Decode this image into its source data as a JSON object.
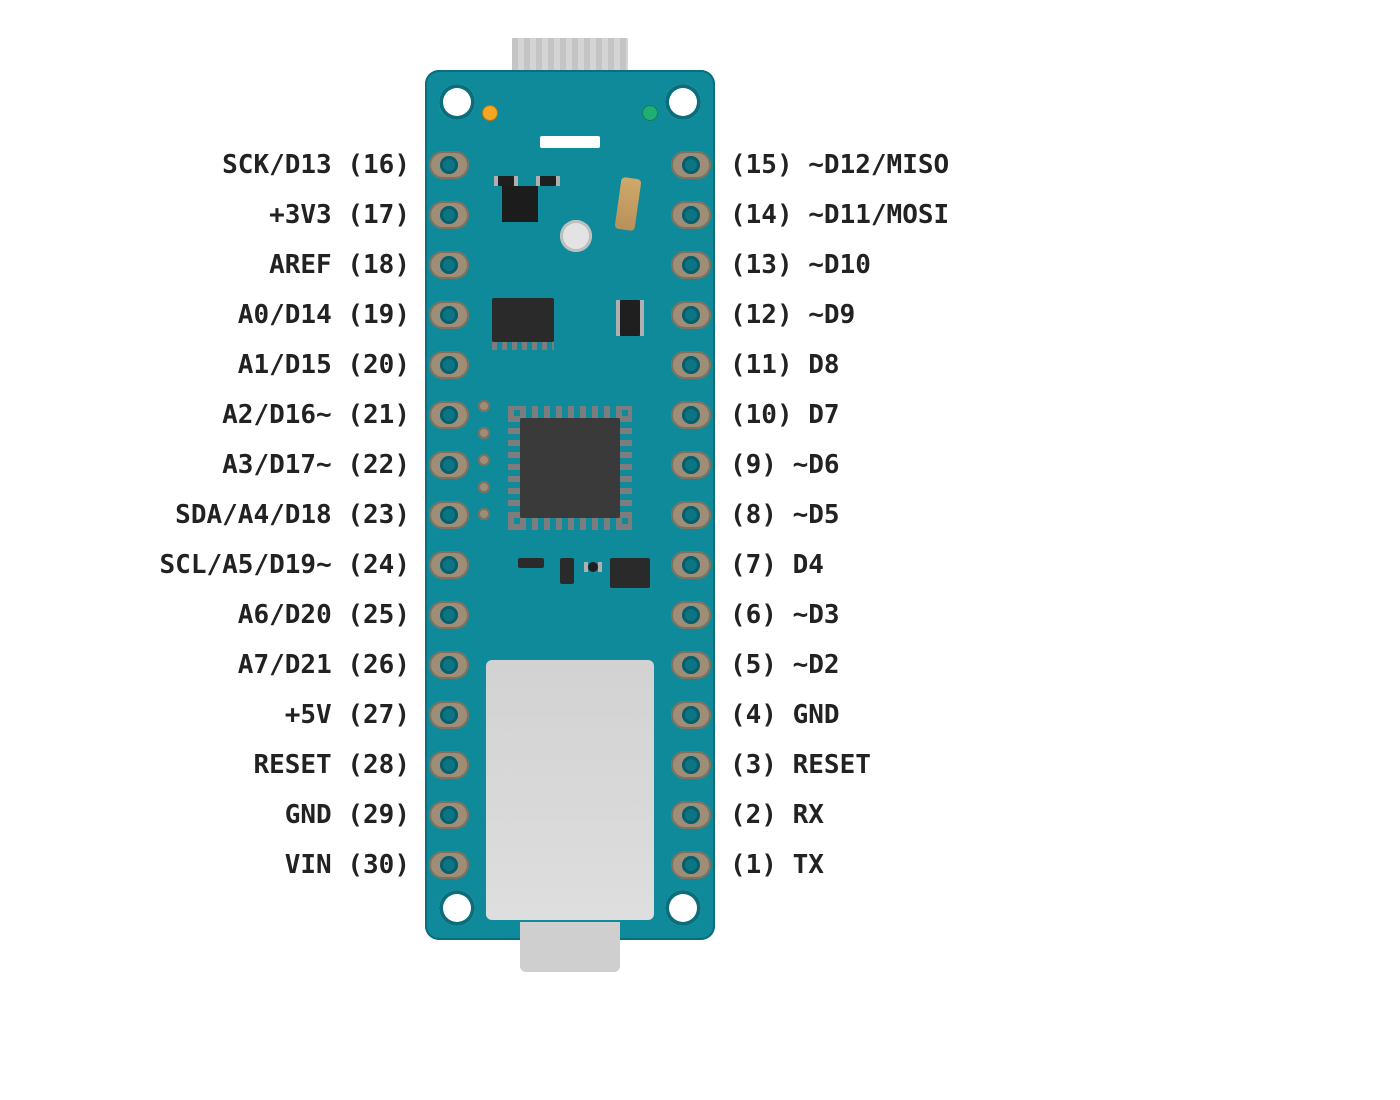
{
  "board": {
    "type": "Arduino-Nano-style microcontroller board pinout diagram",
    "colors": {
      "pcb": "#0f8a9a",
      "pcb_edge": "#0a6f7c",
      "pad": "#9e8e78",
      "pad_hole": "#0b7584",
      "metal": "#d2d2d2",
      "led_orange": "#f5a623",
      "led_green": "#1fae74",
      "text": "#222222"
    }
  },
  "left_pins": [
    {
      "num": "(16)",
      "name": "SCK/D13"
    },
    {
      "num": "(17)",
      "name": "+3V3"
    },
    {
      "num": "(18)",
      "name": "AREF"
    },
    {
      "num": "(19)",
      "name": "A0/D14"
    },
    {
      "num": "(20)",
      "name": "A1/D15"
    },
    {
      "num": "(21)",
      "name": "A2/D16~"
    },
    {
      "num": "(22)",
      "name": "A3/D17~"
    },
    {
      "num": "(23)",
      "name": "SDA/A4/D18"
    },
    {
      "num": "(24)",
      "name": "SCL/A5/D19~"
    },
    {
      "num": "(25)",
      "name": "A6/D20"
    },
    {
      "num": "(26)",
      "name": "A7/D21"
    },
    {
      "num": "(27)",
      "name": "+5V"
    },
    {
      "num": "(28)",
      "name": "RESET"
    },
    {
      "num": "(29)",
      "name": "GND"
    },
    {
      "num": "(30)",
      "name": "VIN"
    }
  ],
  "right_pins": [
    {
      "num": "(15)",
      "name": "~D12/MISO"
    },
    {
      "num": "(14)",
      "name": "~D11/MOSI"
    },
    {
      "num": "(13)",
      "name": "~D10"
    },
    {
      "num": "(12)",
      "name": "~D9"
    },
    {
      "num": "(11)",
      "name": "D8"
    },
    {
      "num": "(10)",
      "name": "D7"
    },
    {
      "num": "(9)",
      "name": "~D6"
    },
    {
      "num": "(8)",
      "name": "~D5"
    },
    {
      "num": "(7)",
      "name": "D4"
    },
    {
      "num": "(6)",
      "name": "~D3"
    },
    {
      "num": "(5)",
      "name": "~D2"
    },
    {
      "num": "(4)",
      "name": "GND"
    },
    {
      "num": "(3)",
      "name": "RESET"
    },
    {
      "num": "(2)",
      "name": "RX"
    },
    {
      "num": "(1)",
      "name": "TX"
    }
  ]
}
